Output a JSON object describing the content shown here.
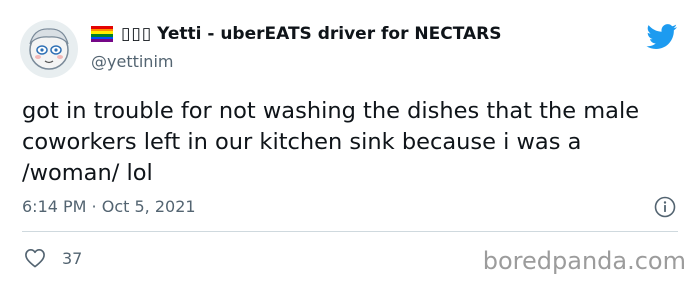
{
  "author": {
    "emoji_placeholder": "▯▯▯",
    "display_name": "Yetti - uberEATS driver for NECTARS",
    "handle": "@yettinim"
  },
  "tweet": {
    "text": "got in trouble for not washing the dishes that the male coworkers left in our kitchen sink because i was a /woman/ lol",
    "timestamp": "6:14 PM · Oct 5, 2021",
    "like_count": "37"
  },
  "watermark": "boredpanda.com",
  "colors": {
    "twitter_blue": "#1d9bf0",
    "muted_gray": "#536471"
  },
  "icons": {
    "bird": "twitter-bird-icon",
    "info": "info-icon",
    "like": "heart-icon",
    "flag": "rainbow-flag-icon"
  }
}
